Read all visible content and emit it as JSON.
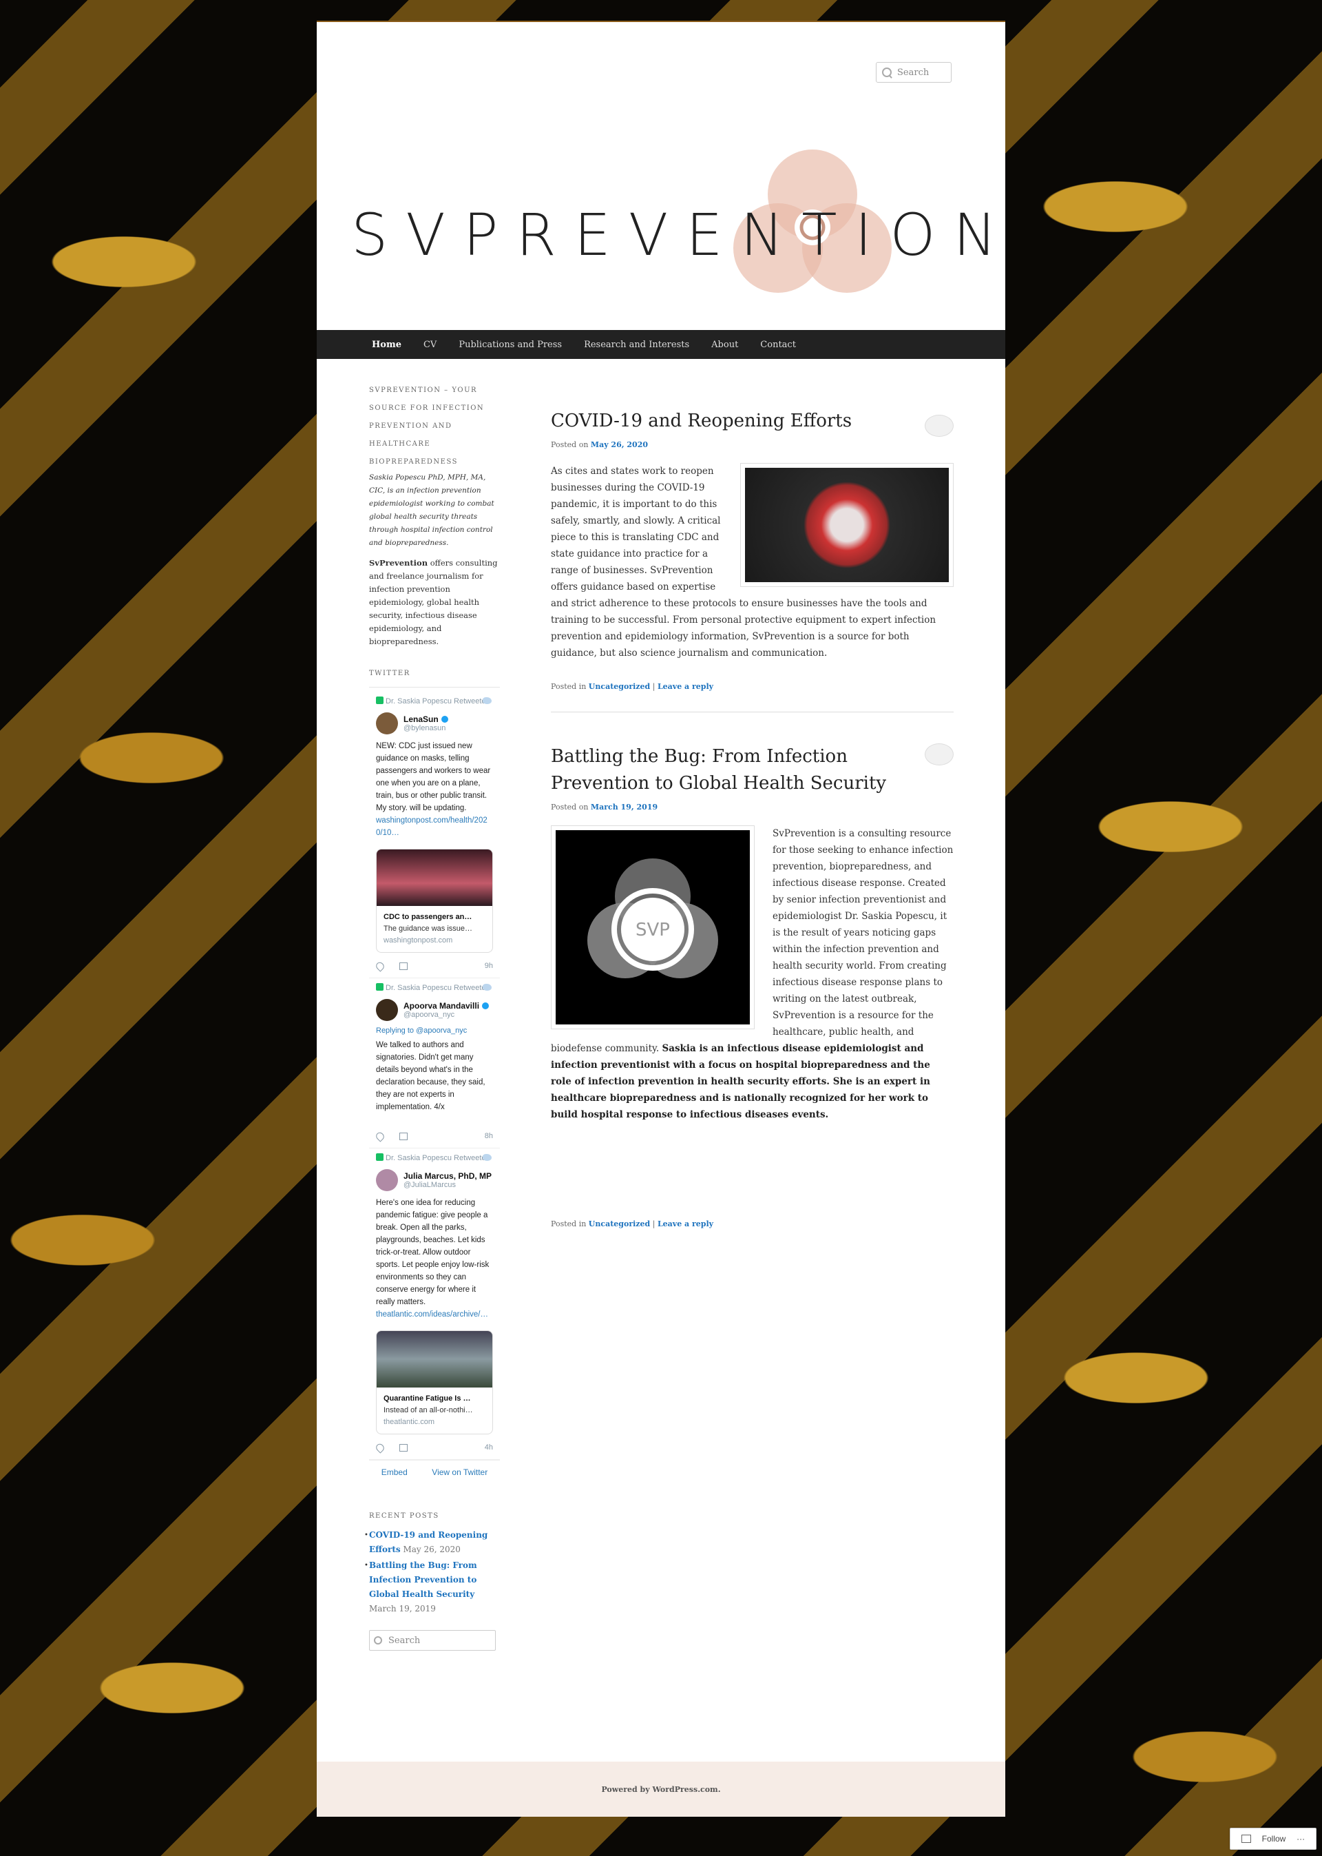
{
  "header": {
    "search_placeholder": "Search",
    "site_title": "SVPREVENTION"
  },
  "nav": {
    "items": [
      "Home",
      "CV",
      "Publications and Press",
      "Research and Interests",
      "About",
      "Contact"
    ],
    "active": "Home"
  },
  "sidebar": {
    "intro_title": "SVPREVENTION – YOUR SOURCE FOR INFECTION PREVENTION AND HEALTHCARE BIOPREPAREDNESS",
    "intro_italic": "Saskia Popescu PhD, MPH, MA, CIC, is an infection prevention epidemiologist working to combat global health security threats through hospital infection control and biopreparedness.",
    "intro_strong": "SvPrevention",
    "intro_rest": " offers consulting and freelance journalism for infection prevention epidemiology, global health security, infectious disease epidemiology, and biopreparedness.",
    "twitter_title": "TWITTER",
    "tweets": [
      {
        "retweeted_by": "Dr. Saskia Popescu Retweeted",
        "author": "LenaSun",
        "handle": "@bylenasun",
        "text": "NEW: CDC just issued new guidance on masks, telling passengers and workers to wear one when you are on a plane, train, bus or other public transit. My story. will be updating.",
        "link": "washingtonpost.com/health/2020/10…",
        "card_title": "CDC to passengers an…",
        "card_desc": "The guidance was issue…",
        "card_domain": "washingtonpost.com",
        "time": "9h"
      },
      {
        "retweeted_by": "Dr. Saskia Popescu Retweeted",
        "author": "Apoorva Mandavilli",
        "handle": "@apoorva_nyc",
        "replying": "Replying to @apoorva_nyc",
        "text": "We talked to authors and signatories. Didn't get many details beyond what's in the declaration because, they said, they are not experts in implementation. 4/x",
        "time": "8h"
      },
      {
        "retweeted_by": "Dr. Saskia Popescu Retweeted",
        "author": "Julia Marcus, PhD, MP",
        "handle": "@JuliaLMarcus",
        "text": "Here's one idea for reducing pandemic fatigue: give people a break. Open all the parks, playgrounds, beaches. Let kids trick-or-treat. Allow outdoor sports. Let people enjoy low-risk environments so they can conserve energy for where it really matters.",
        "link": "theatlantic.com/ideas/archive/…",
        "card_title": "Quarantine Fatigue Is …",
        "card_desc": "Instead of an all-or-nothi…",
        "card_domain": "theatlantic.com",
        "time": "4h"
      }
    ],
    "embed_label": "Embed",
    "view_label": "View on Twitter",
    "recent_title": "RECENT POSTS",
    "recent_posts": [
      {
        "title": "COVID-19 and Reopening Efforts",
        "date": "May 26, 2020"
      },
      {
        "title": "Battling the Bug: From Infection Prevention to Global Health Security",
        "date": "March 19, 2019"
      }
    ],
    "search_placeholder": "Search"
  },
  "posts": [
    {
      "title": "COVID-19 and Reopening Efforts",
      "posted_on_label": "Posted on",
      "date": "May 26, 2020",
      "body": "As cites and states work to reopen businesses during the COVID-19 pandemic, it is important to do this safely, smartly, and slowly. A critical piece to this is translating CDC and state guidance into practice for a range of businesses. SvPrevention offers guidance based on expertise and strict adherence to these protocols to ensure businesses have the tools and training to be successful. From personal protective equipment to expert infection prevention and epidemiology information, SvPrevention is a source for both guidance, but also science journalism and communication.",
      "posted_in_label": "Posted in",
      "category": "Uncategorized",
      "reply_label": "Leave a reply"
    },
    {
      "title": "Battling the Bug: From Infection Prevention to Global Health Security",
      "posted_on_label": "Posted on",
      "date": "March 19, 2019",
      "body": "SvPrevention is a consulting resource for those seeking to enhance infection prevention, biopreparedness, and infectious disease response. Created by senior infection preventionist and epidemiologist Dr. Saskia Popescu, it is the result of years noticing gaps within the infection prevention and health security world. From creating infectious disease response plans to writing on the latest outbreak, SvPrevention is a resource for the healthcare, public health, and biodefense community. ",
      "body_bold": "Saskia is an infectious disease epidemiologist and infection preventionist with a focus on hospital biopreparedness and the role of infection prevention in health security efforts. She is an expert in healthcare biopreparedness and is nationally recognized for her work to build hospital response to infectious diseases events.",
      "image_text": "SVP",
      "posted_in_label": "Posted in",
      "category": "Uncategorized",
      "reply_label": "Leave a reply"
    }
  ],
  "footer": {
    "powered_by": "Powered by WordPress.com."
  },
  "follow": {
    "label": "Follow"
  }
}
